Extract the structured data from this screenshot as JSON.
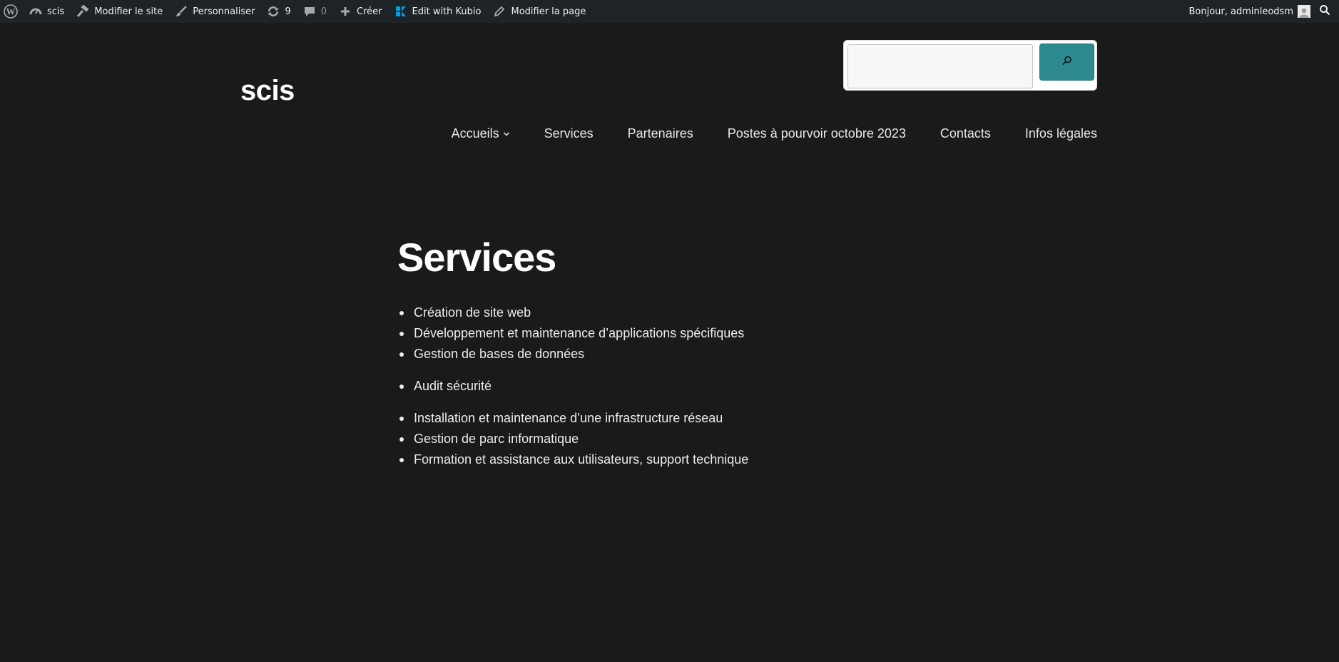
{
  "admin_bar": {
    "site_name": "scis",
    "edit_site": "Modifier le site",
    "customize": "Personnaliser",
    "updates_count": "9",
    "comments_count": "0",
    "new": "Créer",
    "kubio": "Edit with Kubio",
    "edit_page": "Modifier la page",
    "greeting": "Bonjour, adminleodsm",
    "icons": [
      "wordpress-logo-icon",
      "dashboard-icon",
      "hammer-icon",
      "brush-icon",
      "update-icon",
      "comment-icon",
      "plus-icon",
      "kubio-icon",
      "pencil-icon",
      "avatar",
      "search-icon"
    ]
  },
  "header": {
    "site_title": "scis",
    "search": {
      "value": "",
      "button_icon": "search-icon",
      "accent": "#2d8a91"
    },
    "nav": [
      {
        "label": "Accueils",
        "has_submenu": true
      },
      {
        "label": "Services"
      },
      {
        "label": "Partenaires"
      },
      {
        "label": "Postes à pourvoir octobre 2023"
      },
      {
        "label": "Contacts"
      },
      {
        "label": "Infos légales"
      }
    ]
  },
  "main": {
    "title": "Services",
    "items": [
      "Création de site web",
      "Développement et maintenance d’applications spécifiques",
      "Gestion de bases de données",
      "Audit sécurité",
      "Installation et maintenance d’une infrastructure réseau",
      "Gestion de parc informatique",
      "Formation et assistance aux utilisateurs, support technique"
    ]
  },
  "colors": {
    "background": "#1a1a1a",
    "admin_bar": "#1d2327",
    "kubio_blue": "#00a0e3"
  }
}
